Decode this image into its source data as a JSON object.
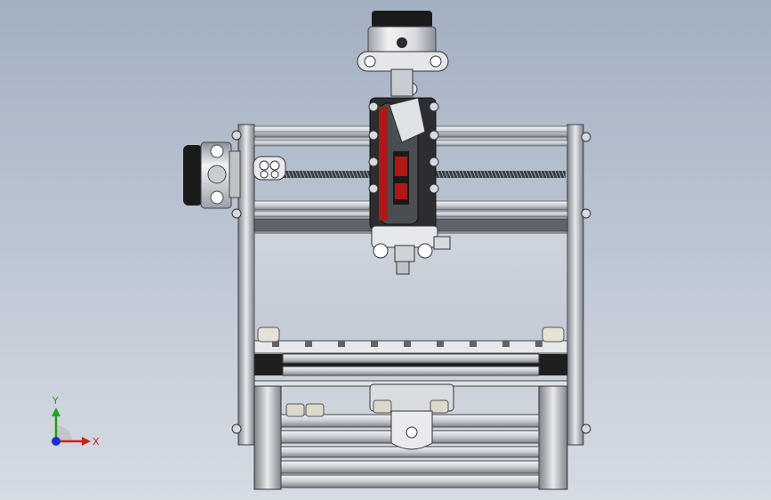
{
  "view": {
    "background_top": "#a3b0c2",
    "background_bottom": "#d6dce4"
  },
  "triad": {
    "x_label": "X",
    "y_label": "Y",
    "x_color": "#d02020",
    "y_color": "#20a020",
    "origin_color": "#1d2fd0"
  },
  "model": {
    "accent_color": "#b01818",
    "metal_light": "#e4e6ea",
    "metal_dark": "#1a1a1a"
  }
}
